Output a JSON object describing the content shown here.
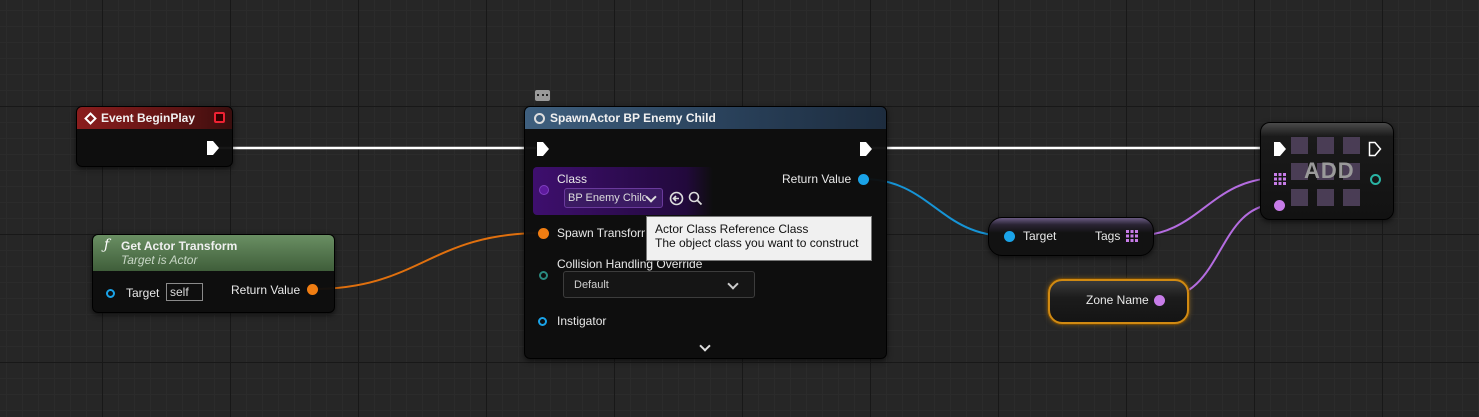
{
  "event_node": {
    "title": "Event BeginPlay"
  },
  "transform_node": {
    "title": "Get Actor Transform",
    "subtitle": "Target is Actor",
    "target_label": "Target",
    "target_value": "self",
    "return_label": "Return Value"
  },
  "spawn_node": {
    "title": "SpawnActor BP Enemy Child",
    "class_label": "Class",
    "class_value": "BP Enemy Child",
    "return_label": "Return Value",
    "transform_label": "Spawn Transform",
    "collision_label": "Collision Handling Override",
    "collision_value": "Default",
    "instigator_label": "Instigator"
  },
  "tooltip": {
    "line1": "Actor Class Reference Class",
    "line2": "The object class you want to construct"
  },
  "tags_node": {
    "target_label": "Target",
    "tags_label": "Tags"
  },
  "zone_node": {
    "label": "Zone Name"
  },
  "add_node": {
    "label": "ADD"
  },
  "colors": {
    "exec": "#ffffff",
    "object": "#1aa3e8",
    "transform": "#f07d12",
    "name": "#c77ce8",
    "class": "#5e1a9e",
    "struct": "#2ab4a4"
  }
}
